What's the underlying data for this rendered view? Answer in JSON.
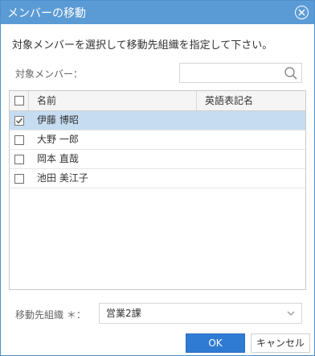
{
  "dialog": {
    "title": "メンバーの移動",
    "instruction": "対象メンバーを選択して移動先組織を指定して下さい。",
    "member_label": "対象メンバー：",
    "search": {
      "value": "",
      "placeholder": ""
    },
    "grid": {
      "columns": [
        "名前",
        "英語表記名"
      ],
      "rows": [
        {
          "name": "伊藤 博昭",
          "english_name": "",
          "checked": true,
          "selected": true
        },
        {
          "name": "大野 一郎",
          "english_name": "",
          "checked": false,
          "selected": false
        },
        {
          "name": "岡本 直哉",
          "english_name": "",
          "checked": false,
          "selected": false
        },
        {
          "name": "池田 美江子",
          "english_name": "",
          "checked": false,
          "selected": false
        }
      ]
    },
    "destination_label": "移動先組織 ＊：",
    "destination_value": "営業2課",
    "ok_label": "OK",
    "cancel_label": "キャンセル"
  },
  "colors": {
    "titlebar": "#5b9bd5",
    "selected_row": "#c6dcf0",
    "primary_button": "#2f7bd4"
  },
  "icons": [
    "close-icon",
    "search-icon",
    "chevron-down-icon",
    "check-icon"
  ]
}
